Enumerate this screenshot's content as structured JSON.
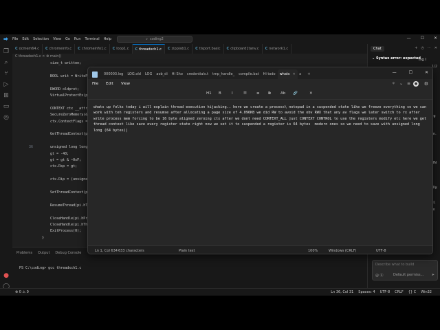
{
  "vscode": {
    "search": "coding2",
    "menu": [
      "File",
      "Edit",
      "Selection",
      "View",
      "Go",
      "Run",
      "Terminal",
      "Help"
    ],
    "tabs": [
      {
        "label": "ocmem64.c",
        "active": false
      },
      {
        "label": "chromeinfo.c",
        "active": false
      },
      {
        "label": "chromeinfo1.c",
        "active": false
      },
      {
        "label": "loop1.c",
        "active": false
      },
      {
        "label": "threadxch1.c",
        "active": true
      },
      {
        "label": "zipplab1.c",
        "active": false
      },
      {
        "label": "tlsport.basic",
        "active": false
      },
      {
        "label": "clipboard1tanv.c",
        "active": false
      },
      {
        "label": "network1.c",
        "active": false
      }
    ],
    "breadcrumb": "C threadxch1.c > ⊗ main()",
    "code": [
      {
        "n": "",
        "t": "    size_t written;"
      },
      {
        "n": "",
        "t": ""
      },
      {
        "n": "",
        "t": "    BOOL writ = WriteProcessMemory(...);"
      },
      {
        "n": "",
        "t": ""
      },
      {
        "n": "",
        "t": "    DWORD oldprot;"
      },
      {
        "n": "",
        "t": "    VirtualProtectEx(pi.hProcess, ...);"
      },
      {
        "n": "",
        "t": ""
      },
      {
        "n": "",
        "t": "    CONTEXT ctx __attribute__((aligned(16)));"
      },
      {
        "n": "",
        "t": "    SecureZeroMemory(&ctx, sizeof(ctx));"
      },
      {
        "n": "",
        "t": "    ctx.ContextFlags = CONTEXT_ALL;"
      },
      {
        "n": "",
        "t": ""
      },
      {
        "n": "",
        "t": "    GetThreadContext(pi.hThread, &ctx);"
      },
      {
        "n": "",
        "t": ""
      },
      {
        "n": "36",
        "t": "    unsigned long long gt = ..."
      },
      {
        "n": "",
        "t": "    gt = -40;"
      },
      {
        "n": "",
        "t": "    gt = gt & ~0xF;"
      },
      {
        "n": "",
        "t": "    ctx.Rsp = gt;"
      },
      {
        "n": "",
        "t": ""
      },
      {
        "n": "",
        "t": "    ctx.Rip = (unsigned long long)..."
      },
      {
        "n": "",
        "t": ""
      },
      {
        "n": "",
        "t": "    SetThreadContext(pi.hThread, &ctx);"
      },
      {
        "n": "",
        "t": ""
      },
      {
        "n": "",
        "t": "    ResumeThread(pi.hThread);"
      },
      {
        "n": "",
        "t": ""
      },
      {
        "n": "",
        "t": "    CloseHandle(pi.hProcess);"
      },
      {
        "n": "",
        "t": "    CloseHandle(pi.hThread);"
      },
      {
        "n": "",
        "t": "    ExitProcess(0);"
      },
      {
        "n": "",
        "t": "}"
      }
    ],
    "panel_tabs": [
      "Problems",
      "Output",
      "Debug Console"
    ],
    "terminal": "PS C:\\coding> gcc threadxch1.c",
    "status_left": [
      "⊗ 0 ⚠ 0"
    ],
    "status_right": [
      "Ln 36, Col 31",
      "Spaces: 4",
      "UTF-8",
      "CRLF",
      "{} C",
      "Win32"
    ],
    "chat": {
      "tab": "Chat",
      "title": "Syntax error: expected",
      "page": "1/2",
      "fragments": [
        "ing l",
        "ead in",
        "call",
        "sight",
        "It is being",
        "r function.",
        "ic is the",
        "SHOWWIN",
        "(0);",
        "pad, or",
        "n normally.",
        "ice",
        "too small.",
        "aitUnicEx"
      ],
      "placeholder": "Describe what to build",
      "mention": "@ Ⓐ",
      "permission": "Default permiss...",
      "send": "➤"
    }
  },
  "notepad": {
    "tabs": [
      {
        "label": "000003.log",
        "active": false
      },
      {
        "label": "LOG.old",
        "active": false
      },
      {
        "label": "LOG",
        "active": false
      },
      {
        "label": "aob_di",
        "active": false
      },
      {
        "label": "Hi Sho",
        "active": false
      },
      {
        "label": "credentials.t",
        "active": false
      },
      {
        "label": "tmp_handle_",
        "active": false
      },
      {
        "label": "compile.bat",
        "active": false
      },
      {
        "label": "Hi todo",
        "active": false
      },
      {
        "label": "whats",
        "active": true
      }
    ],
    "menu": [
      "File",
      "Edit",
      "View"
    ],
    "format": [
      "H1",
      "B",
      "I",
      "☰",
      "≡",
      "⧉",
      "Ab",
      "🔗",
      "✕"
    ],
    "text": "whats up folks today i will explain thread execution hijacking.. here we create a process\\ notepad in a suspended state like we freeze everything so we can work with teh registers and resumse after allocating a page size of 4.096KB we did RW to avoid the obv RWX that any av flags we later switch to rx after write process mem forcing to be 16 byte aligned zeroing ctx after we dont need CONTEXT_ALL just CONTEXT CONTROL to use the registers modify etc here we get thread context like save every register state right now we set it to suspended a register is 64 bytes  modern ones so we need to save with unsigned long long (64 bytes)|",
    "status": {
      "pos": "Ln 1, Col 634",
      "chars": "633 characters",
      "format": "Plain text",
      "zoom": "100%",
      "eol": "Windows (CRLF)",
      "enc": "UTF-8"
    }
  }
}
